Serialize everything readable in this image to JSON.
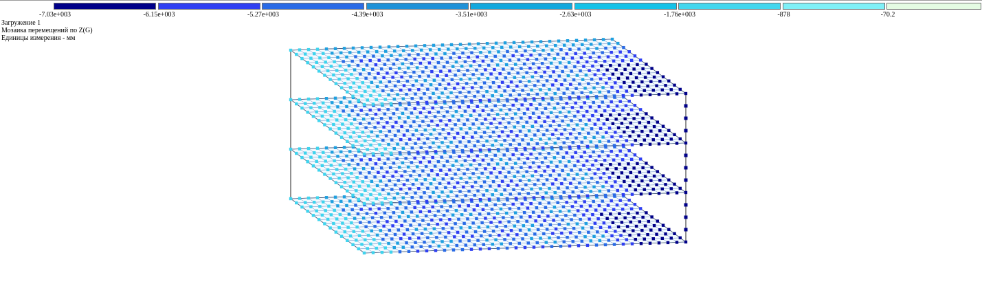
{
  "legend": {
    "swatches": [
      {
        "color": "#000088"
      },
      {
        "color": "#2f3ff2"
      },
      {
        "color": "#2a6be6"
      },
      {
        "color": "#1f92d8"
      },
      {
        "color": "#12a8dd"
      },
      {
        "color": "#14c2e8"
      },
      {
        "color": "#43d7ee"
      },
      {
        "color": "#7ff0f7"
      },
      {
        "color": "#e4fbe3"
      }
    ],
    "ticks": [
      "-7.03e+003",
      "-6.15e+003",
      "-5.27e+003",
      "-4.39e+003",
      "-3.51e+003",
      "-2.63e+003",
      "-1.76e+003",
      "-878",
      "-70.2"
    ]
  },
  "info": {
    "load_case": "Загружение 1",
    "mosaic_title": "Мозаика перемещений по Z(G)",
    "units": "Единицы измерения - мм"
  },
  "model": {
    "floor_count": 4,
    "colors": {
      "deep": "#000088",
      "mid_dark": "#2f3ff2",
      "mid": "#2a6be6",
      "light": "#1fa0e0",
      "lightest": "#3fd4ee",
      "frame": "#222222"
    }
  }
}
